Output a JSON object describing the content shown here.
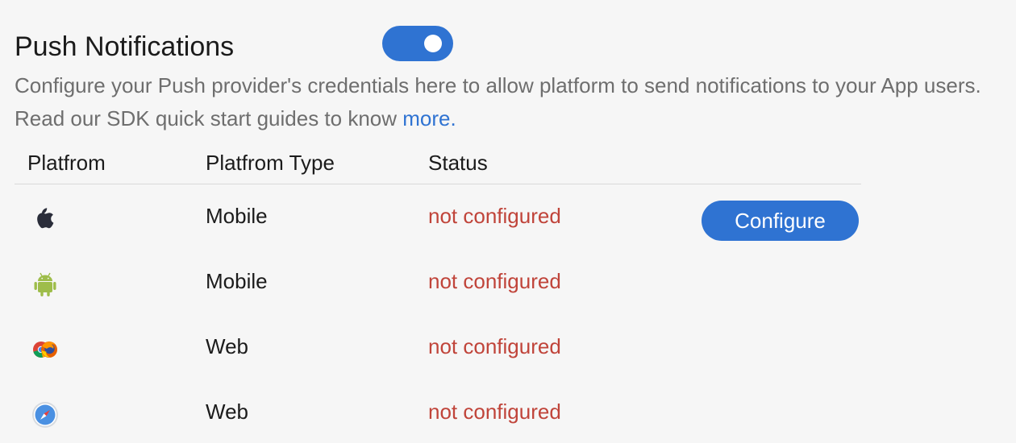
{
  "header": {
    "title": "Push Notifications",
    "toggle_on": true
  },
  "description": {
    "text": "Configure your Push provider's credentials here to allow platform to send notifications to your App users. Read our SDK quick start guides to know ",
    "link_text": "more."
  },
  "table": {
    "columns": [
      "Platfrom",
      "Platfrom Type",
      "Status"
    ],
    "rows": [
      {
        "platform_icon": "apple-icon",
        "type": "Mobile",
        "status": "not configured",
        "action_label": "Configure"
      },
      {
        "platform_icon": "android-icon",
        "type": "Mobile",
        "status": "not configured"
      },
      {
        "platform_icon": "chrome-firefox-icon",
        "type": "Web",
        "status": "not configured"
      },
      {
        "platform_icon": "safari-icon",
        "type": "Web",
        "status": "not configured"
      }
    ]
  },
  "colors": {
    "accent": "#2f73d2",
    "status_error": "#c0443a",
    "muted_text": "#6e6e6e",
    "background": "#f6f6f6"
  }
}
